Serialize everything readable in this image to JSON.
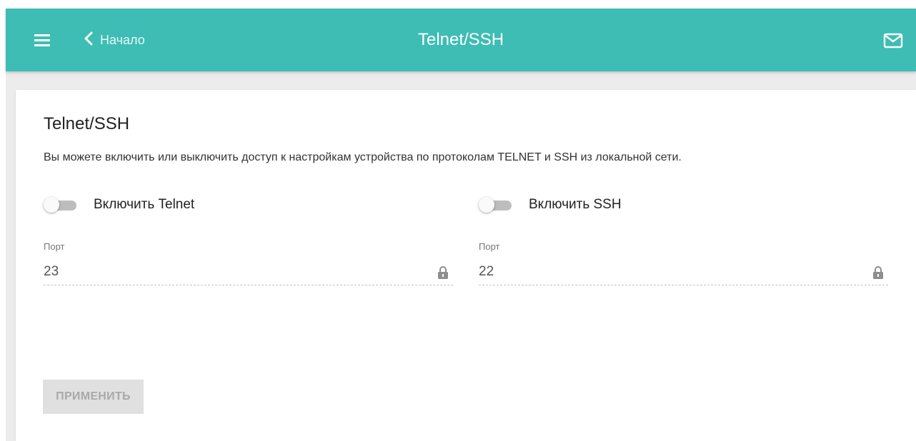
{
  "header": {
    "back_label": "Начало",
    "title": "Telnet/SSH",
    "menu_icon": "hamburger-menu-icon",
    "back_icon": "chevron-left-icon",
    "mail_icon": "envelope-icon",
    "background_color": "#3dbdb4"
  },
  "card": {
    "title": "Telnet/SSH",
    "description": "Вы можете включить или выключить доступ к настройкам устройства по протоколам TELNET и SSH из локальной сети."
  },
  "telnet": {
    "toggle_label": "Включить Telnet",
    "enabled": false,
    "port_label": "Порт",
    "port_value": "23",
    "lock_icon": "lock-icon"
  },
  "ssh": {
    "toggle_label": "Включить SSH",
    "enabled": false,
    "port_label": "Порт",
    "port_value": "22",
    "lock_icon": "lock-icon"
  },
  "actions": {
    "apply_label": "ПРИМЕНИТЬ",
    "apply_disabled": true
  }
}
